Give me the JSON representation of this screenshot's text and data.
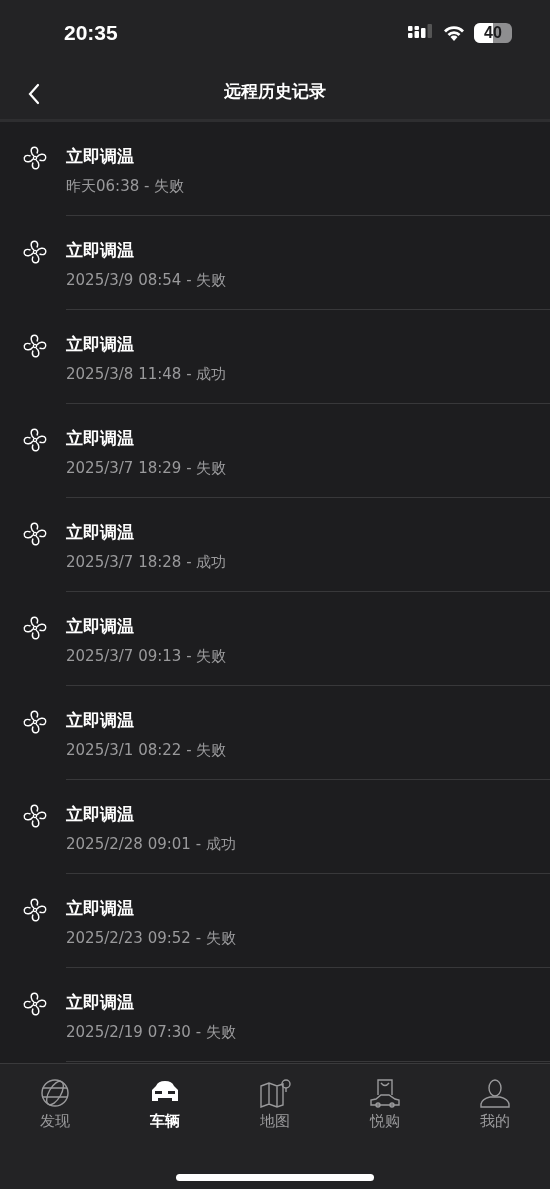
{
  "status_bar": {
    "time": "20:35",
    "battery": "40"
  },
  "header": {
    "title": "远程历史记录"
  },
  "records": [
    {
      "title": "立即调温",
      "detail": "昨天06:38 - 失败"
    },
    {
      "title": "立即调温",
      "detail": "2025/3/9 08:54 - 失败"
    },
    {
      "title": "立即调温",
      "detail": "2025/3/8 11:48 - 成功"
    },
    {
      "title": "立即调温",
      "detail": "2025/3/7 18:29 - 失败"
    },
    {
      "title": "立即调温",
      "detail": "2025/3/7 18:28 - 成功"
    },
    {
      "title": "立即调温",
      "detail": "2025/3/7 09:13 - 失败"
    },
    {
      "title": "立即调温",
      "detail": "2025/3/1 08:22 - 失败"
    },
    {
      "title": "立即调温",
      "detail": "2025/2/28 09:01 - 成功"
    },
    {
      "title": "立即调温",
      "detail": "2025/2/23 09:52 - 失败"
    },
    {
      "title": "立即调温",
      "detail": "2025/2/19 07:30 - 失败"
    }
  ],
  "tab_bar": [
    {
      "label": "发现",
      "kind": "globe",
      "selected": false
    },
    {
      "label": "车辆",
      "kind": "car",
      "selected": true
    },
    {
      "label": "地图",
      "kind": "map",
      "selected": false
    },
    {
      "label": "悦购",
      "kind": "shop",
      "selected": false
    },
    {
      "label": "我的",
      "kind": "person",
      "selected": false
    }
  ]
}
